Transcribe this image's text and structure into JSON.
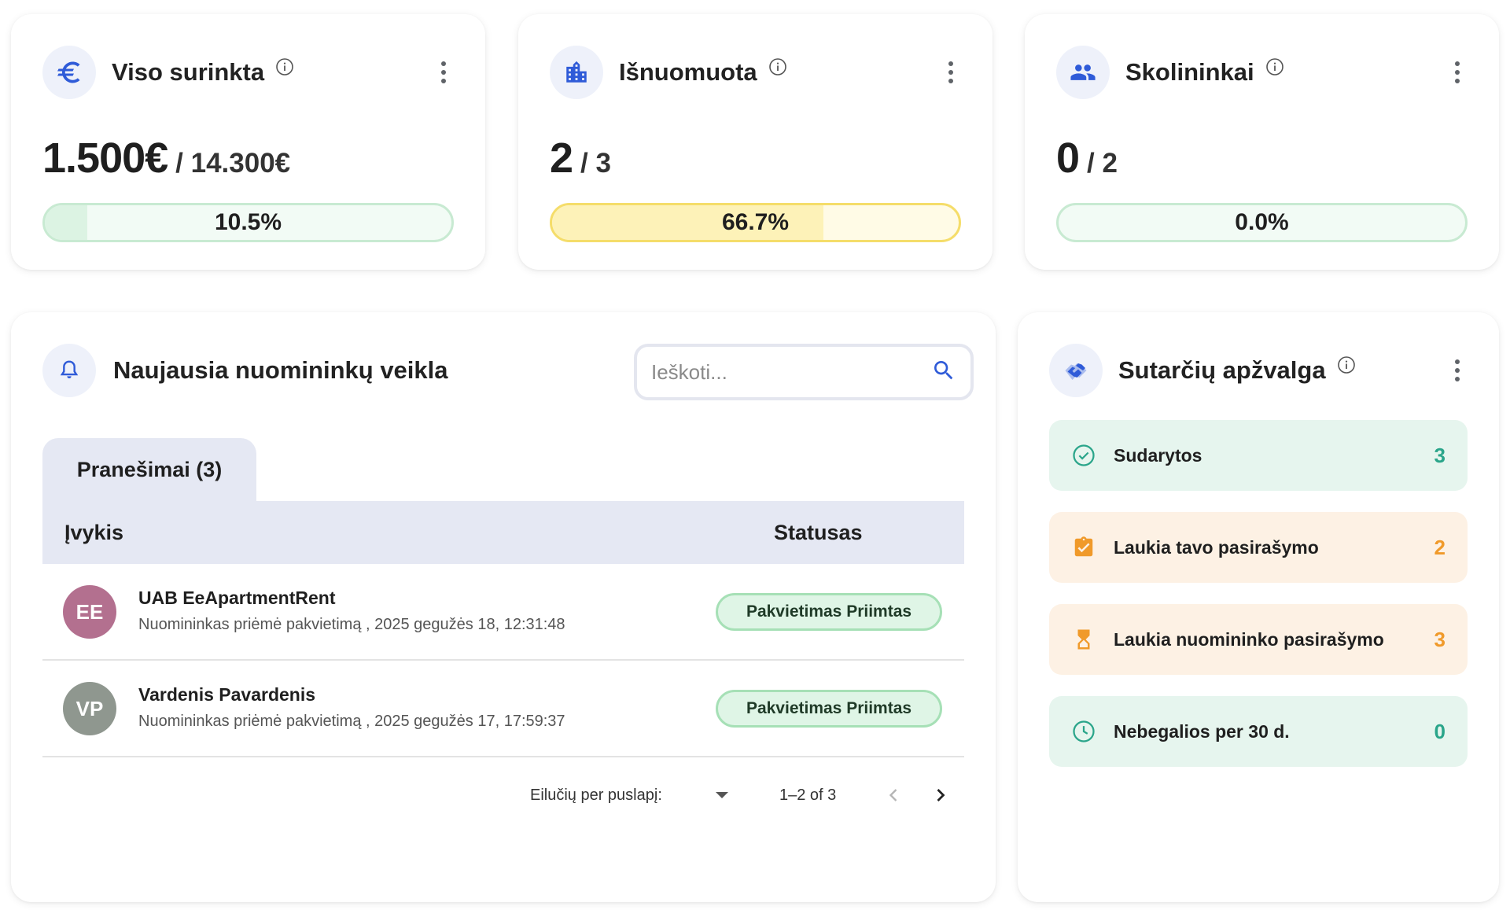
{
  "colors": {
    "accent": "#2f5bd8",
    "green_fill": "#dff5e6",
    "green_border": "#a6e0b6",
    "yellow_fill": "#fdf2b8",
    "yellow_border": "#f5dd6a",
    "teal": "#2aa58a",
    "orange": "#f09a2a"
  },
  "cards": [
    {
      "icon": "euro-icon",
      "title": "Viso surinkta",
      "value": "1.500€",
      "total": "/ 14.300€",
      "percent_label": "10.5%",
      "percent": 10.5
    },
    {
      "icon": "building-icon",
      "title": "Išnuomuota",
      "value": "2",
      "total": "/ 3",
      "percent_label": "66.7%",
      "percent": 66.7
    },
    {
      "icon": "people-icon",
      "title": "Skolininkai",
      "value": "0",
      "total": "/ 2",
      "percent_label": "0.0%",
      "percent": 0
    }
  ],
  "activity": {
    "title": "Naujausia nuomininkų veikla",
    "search_placeholder": "Ieškoti...",
    "tab_label": "Pranešimai (3)",
    "columns": [
      "Įvykis",
      "Statusas"
    ],
    "rows": [
      {
        "initials": "EE",
        "avatar_color": "#b3708f",
        "name": "UAB EeApartmentRent",
        "detail": "Nuomininkas priėmė pakvietimą , 2025 gegužės 18, 12:31:48",
        "status": "Pakvietimas Priimtas"
      },
      {
        "initials": "VP",
        "avatar_color": "#8f978f",
        "name": "Vardenis Pavardenis",
        "detail": "Nuomininkas priėmė pakvietimą , 2025 gegužės 17, 17:59:37",
        "status": "Pakvietimas Priimtas"
      }
    ],
    "pagination": {
      "rows_per_page_label": "Eilučių per puslapį:",
      "range": "1–2 of 3"
    }
  },
  "contracts": {
    "title": "Sutarčių apžvalga",
    "items": [
      {
        "icon": "check-circle-icon",
        "label": "Sudarytos",
        "count": "3",
        "bg": "#e6f5ee",
        "color": "#2aa58a"
      },
      {
        "icon": "clipboard-check-icon",
        "label": "Laukia tavo pasirašymo",
        "count": "2",
        "bg": "#fdf1e4",
        "color": "#f09a2a"
      },
      {
        "icon": "hourglass-icon",
        "label": "Laukia nuomininko pasirašymo",
        "count": "3",
        "bg": "#fdf1e4",
        "color": "#f09a2a"
      },
      {
        "icon": "clock-icon",
        "label": "Nebegalios per 30 d.",
        "count": "0",
        "bg": "#e6f5ee",
        "color": "#2aa58a"
      }
    ]
  }
}
